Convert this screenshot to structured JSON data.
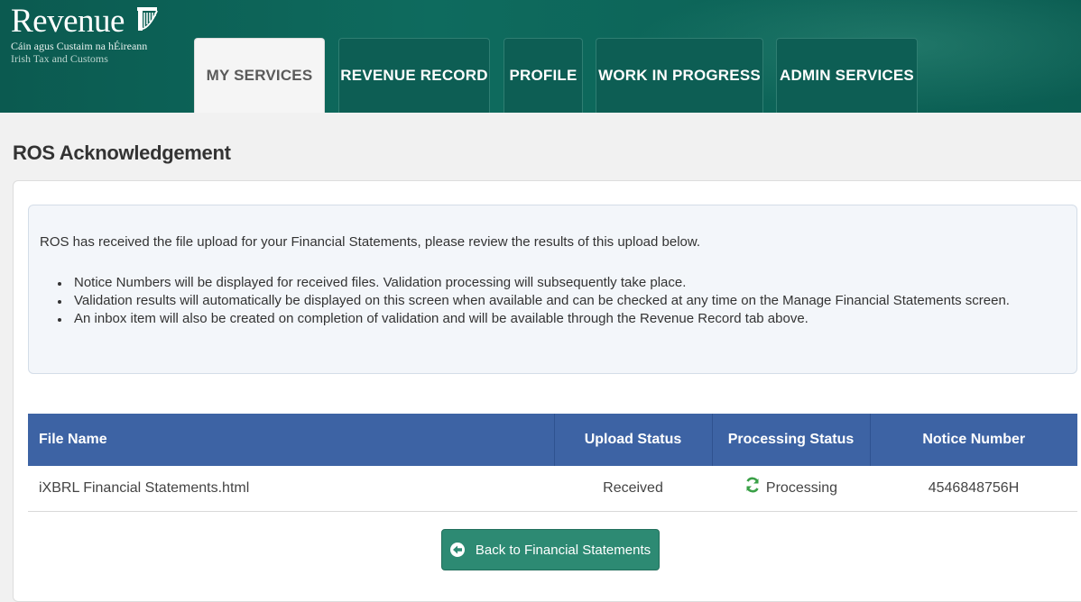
{
  "header": {
    "logo_title": "Revenue",
    "logo_subtitle_irish": "Cáin agus Custaim na hÉireann",
    "logo_subtitle_english": "Irish Tax and Customs",
    "tabs": [
      {
        "label": "MY SERVICES",
        "active": true
      },
      {
        "label": "REVENUE RECORD",
        "active": false
      },
      {
        "label": "PROFILE",
        "active": false
      },
      {
        "label": "WORK IN PROGRESS",
        "active": false
      },
      {
        "label": "ADMIN SERVICES",
        "active": false
      }
    ]
  },
  "page_title": "ROS Acknowledgement",
  "info": {
    "intro": "ROS has received the file upload for your Financial Statements, please review the results of this upload below.",
    "bullets": [
      "Notice Numbers will be displayed for received files. Validation processing will subsequently take place.",
      "Validation results will automatically be displayed on this screen when available and can be checked at any time on the Manage Financial Statements screen.",
      "An inbox item will also be created on completion of validation and will be available through the Revenue Record tab above."
    ]
  },
  "table": {
    "headers": [
      "File Name",
      "Upload Status",
      "Processing Status",
      "Notice Number"
    ],
    "rows": [
      {
        "file_name": "iXBRL Financial Statements.html",
        "upload_status": "Received",
        "processing_status": "Processing",
        "notice_number": "4546848756H"
      }
    ]
  },
  "back_button_label": "Back to Financial Statements",
  "colors": {
    "header_green": "#0d5e54",
    "table_header_blue": "#3d63a4",
    "button_green": "#2d8a73",
    "processing_icon_green": "#3aa047"
  },
  "icons": {
    "logo": "harp-icon",
    "processing": "refresh-icon",
    "back": "arrow-left-icon"
  }
}
